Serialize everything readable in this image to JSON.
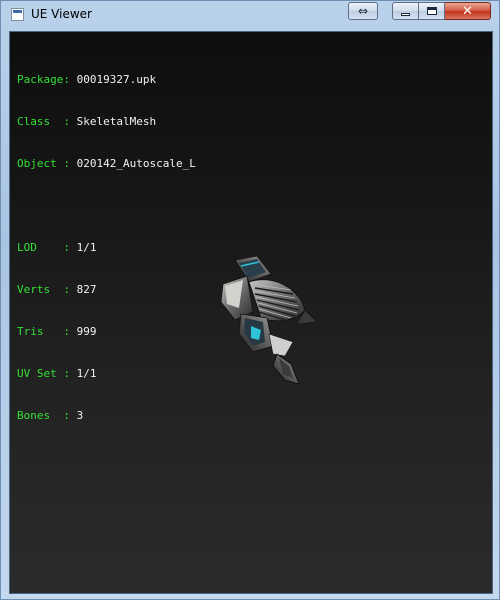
{
  "window": {
    "title": "UE Viewer",
    "icon": "app-icon",
    "controls": {
      "extra": "⇔",
      "close": "✕"
    }
  },
  "info": {
    "separator": ":",
    "package": {
      "label": "Package",
      "value": "00019327.upk"
    },
    "class": {
      "label": "Class  ",
      "value": "SkeletalMesh"
    },
    "object": {
      "label": "Object ",
      "value": "020142_Autoscale_L"
    },
    "lod": {
      "label": "LOD    ",
      "value": "1/1"
    },
    "verts": {
      "label": "Verts  ",
      "value": "827"
    },
    "tris": {
      "label": "Tris   ",
      "value": "999"
    },
    "uvset": {
      "label": "UV Set ",
      "value": "1/1"
    },
    "bones": {
      "label": "Bones  ",
      "value": "3"
    }
  },
  "colors": {
    "label_green": "#35e035",
    "value_white": "#f2f2f2",
    "viewport_bg": "#1a1a1a",
    "mesh_accent": "#2ec6d6"
  }
}
